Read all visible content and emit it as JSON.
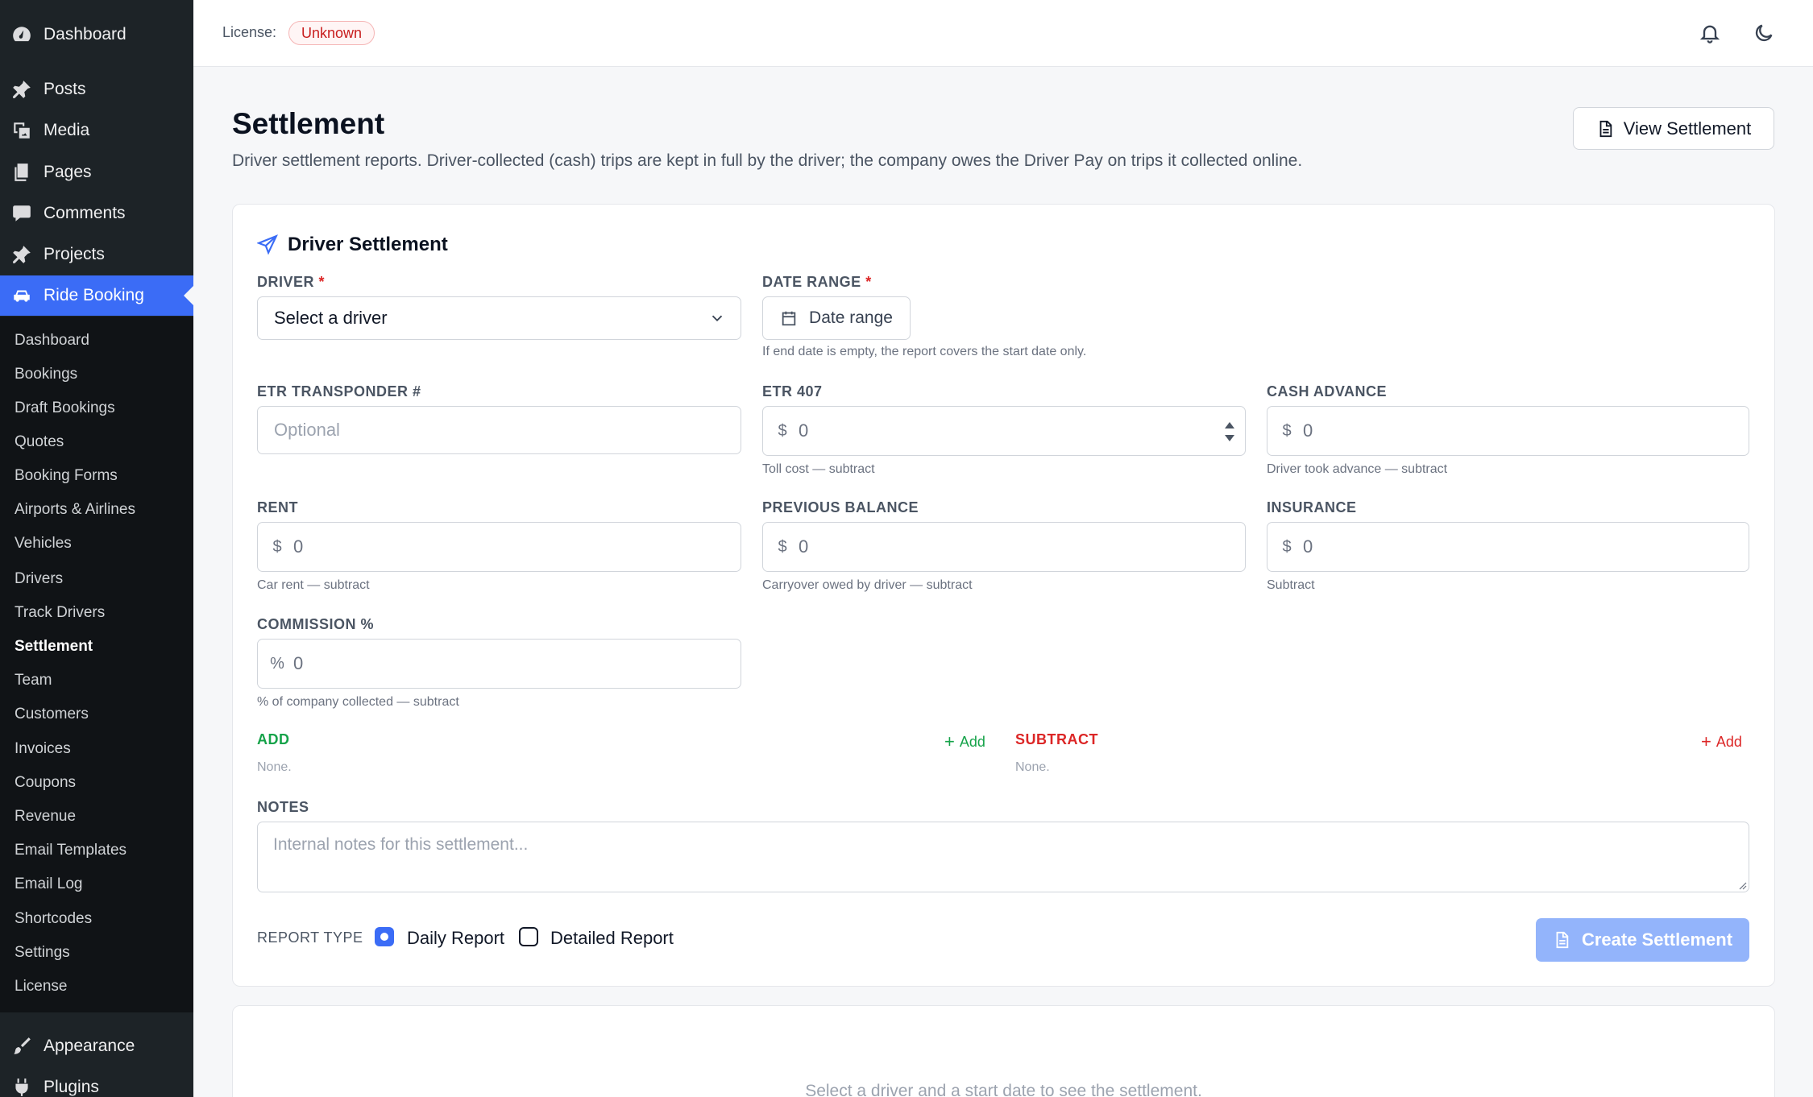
{
  "sidebar": {
    "top_items": [
      {
        "label": "Dashboard",
        "icon": "dashboard-icon"
      },
      {
        "label": "Posts",
        "icon": "pin-icon"
      },
      {
        "label": "Media",
        "icon": "media-icon"
      },
      {
        "label": "Pages",
        "icon": "pages-icon"
      },
      {
        "label": "Comments",
        "icon": "comment-icon"
      },
      {
        "label": "Projects",
        "icon": "pin-icon"
      },
      {
        "label": "Ride Booking",
        "icon": "car-icon"
      }
    ],
    "sub_items": [
      "Dashboard",
      "Bookings",
      "Draft Bookings",
      "Quotes",
      "Booking Forms",
      "Airports & Airlines",
      "Vehicles",
      "Drivers",
      "Track Drivers",
      "Settlement",
      "Team",
      "Customers",
      "Invoices",
      "Coupons",
      "Revenue",
      "Email Templates",
      "Email Log",
      "Shortcodes",
      "Settings",
      "License"
    ],
    "bottom_items": [
      {
        "label": "Appearance",
        "icon": "brush-icon"
      },
      {
        "label": "Plugins",
        "icon": "plugin-icon"
      }
    ]
  },
  "topbar": {
    "license_label": "License:",
    "license_status": "Unknown"
  },
  "page": {
    "title": "Settlement",
    "subtitle": "Driver settlement reports. Driver-collected (cash) trips are kept in full by the driver; the company owes the Driver Pay on trips it collected online.",
    "view_button": "View Settlement"
  },
  "form": {
    "title": "Driver Settlement",
    "driver": {
      "label": "DRIVER",
      "req": "*",
      "value": "Select a driver"
    },
    "date_range": {
      "label": "DATE RANGE",
      "req": "*",
      "button": "Date range",
      "hint": "If end date is empty, the report covers the start date only."
    },
    "etr_transponder": {
      "label": "ETR TRANSPONDER #",
      "placeholder": "Optional"
    },
    "etr_407": {
      "label": "ETR 407",
      "prefix": "$",
      "value": "0",
      "hint": "Toll cost — subtract"
    },
    "cash_advance": {
      "label": "CASH ADVANCE",
      "prefix": "$",
      "value": "0",
      "hint": "Driver took advance — subtract"
    },
    "rent": {
      "label": "RENT",
      "prefix": "$",
      "value": "0",
      "hint": "Car rent — subtract"
    },
    "previous_balance": {
      "label": "PREVIOUS BALANCE",
      "prefix": "$",
      "value": "0",
      "hint": "Carryover owed by driver — subtract"
    },
    "insurance": {
      "label": "INSURANCE",
      "prefix": "$",
      "value": "0",
      "hint": "Subtract"
    },
    "commission": {
      "label": "COMMISSION %",
      "prefix": "%",
      "value": "0",
      "hint": "% of company collected — subtract"
    },
    "add": {
      "label": "ADD",
      "link": "Add",
      "none": "None."
    },
    "subtract": {
      "label": "SUBTRACT",
      "link": "Add",
      "none": "None."
    },
    "notes": {
      "label": "NOTES",
      "placeholder": "Internal notes for this settlement..."
    },
    "report_type": {
      "label": "REPORT TYPE",
      "options": [
        "Daily Report",
        "Detailed Report"
      ],
      "selected": "Daily Report"
    },
    "create_button": "Create Settlement"
  },
  "result": {
    "empty_message": "Select a driver and a start date to see the settlement."
  },
  "colors": {
    "accent": "#3b6cf6",
    "sidebar": "#1d2327",
    "add": "#16a34a",
    "subtract": "#dc2626"
  }
}
